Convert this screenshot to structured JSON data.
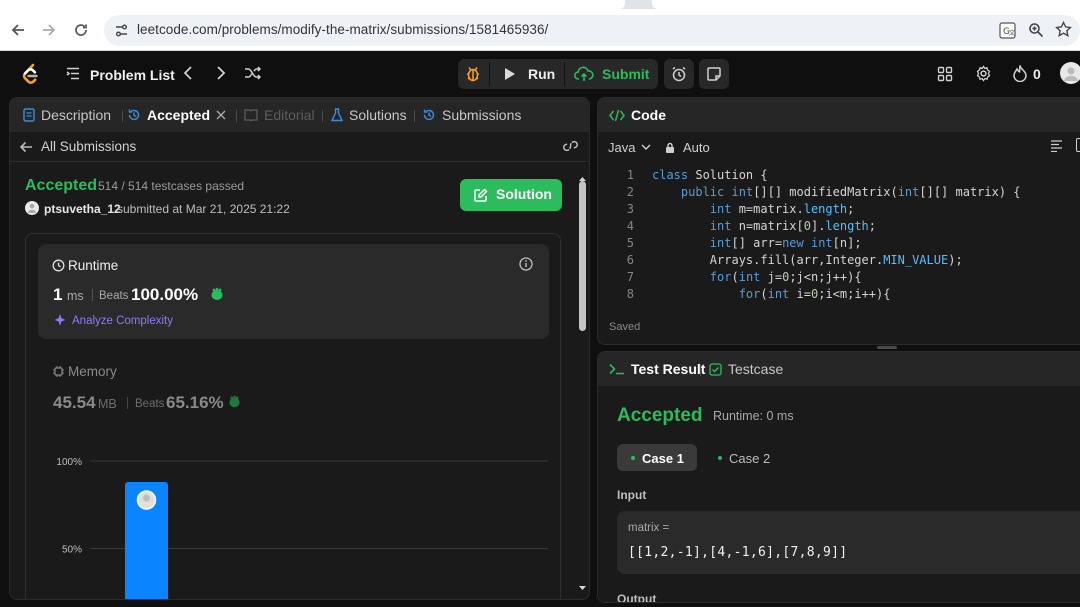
{
  "browser": {
    "url": "leetcode.com/problems/modify-the-matrix/submissions/1581465936/"
  },
  "header": {
    "problem_list": "Problem List",
    "run": "Run",
    "submit": "Submit",
    "streak": "0"
  },
  "left_panel": {
    "tabs": {
      "description": "Description",
      "accepted": "Accepted",
      "editorial": "Editorial",
      "solutions": "Solutions",
      "submissions": "Submissions"
    },
    "back": "All Submissions",
    "status": "Accepted",
    "testcases": "514 / 514 testcases passed",
    "user": "ptsuvetha_12",
    "submitted": "submitted at Mar 21, 2025 21:22",
    "solution_button": "Solution",
    "runtime": {
      "title": "Runtime",
      "value": "1",
      "unit": "ms",
      "beats_label": "Beats",
      "beats_value": "100.00%",
      "analyze": "Analyze Complexity"
    },
    "memory": {
      "title": "Memory",
      "value": "45.54",
      "unit": "MB",
      "beats_label": "Beats",
      "beats_value": "65.16%"
    },
    "chart": {
      "ticks": [
        "100%",
        "50%"
      ]
    }
  },
  "chart_data": {
    "type": "bar",
    "ylim": [
      0,
      100
    ],
    "yticks": [
      "100%",
      "50%"
    ],
    "values": [
      88
    ],
    "highlight_index": 0
  },
  "code_panel": {
    "title": "Code",
    "language": "Java",
    "auto": "Auto",
    "saved": "Saved",
    "line_numbers": [
      "1",
      "2",
      "3",
      "4",
      "5",
      "6",
      "7",
      "8"
    ],
    "lines": [
      "class Solution {",
      "    public int[][] modifiedMatrix(int[][] matrix) {",
      "        int m=matrix.length;",
      "        int n=matrix[0].length;",
      "        int[] arr=new int[n];",
      "        Arrays.fill(arr,Integer.MIN_VALUE);",
      "        for(int j=0;j<n;j++){",
      "            for(int i=0;i<m;i++){"
    ]
  },
  "result_panel": {
    "tabs": {
      "test_result": "Test Result",
      "testcase": "Testcase"
    },
    "status": "Accepted",
    "runtime": "Runtime: 0 ms",
    "cases": [
      "Case 1",
      "Case 2"
    ],
    "input_label": "Input",
    "var_name": "matrix =",
    "var_value": "[[1,2,-1],[4,-1,6],[7,8,9]]",
    "output_label": "Output"
  },
  "colors": {
    "accent_green": "#2cbb5d",
    "bar_blue": "#0a84ff",
    "analyze_purple": "#8b7bff"
  }
}
